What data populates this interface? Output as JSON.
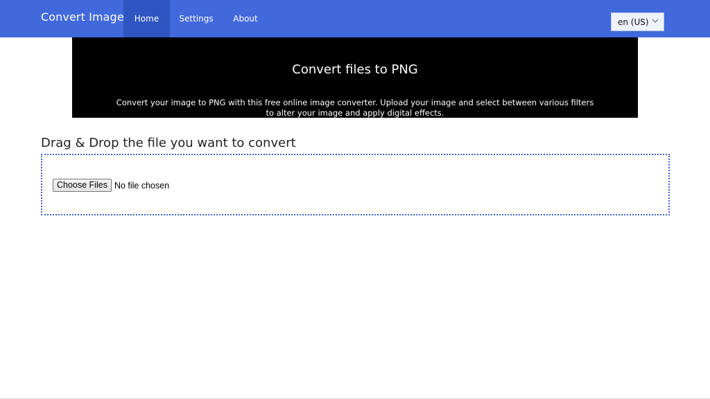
{
  "app": {
    "brand": "Convert Image"
  },
  "nav": {
    "items": [
      {
        "label": "Home",
        "active": true
      },
      {
        "label": "Settings",
        "active": false
      },
      {
        "label": "About",
        "active": false
      }
    ]
  },
  "language": {
    "selected": "en (US)",
    "icon": "chevron-down-icon"
  },
  "hero": {
    "title": "Convert files to PNG",
    "description": "Convert your image to PNG with this free online image converter. Upload your image and select between various filters to alter your image and apply digital effects."
  },
  "upload": {
    "heading": "Drag & Drop the file you want to convert",
    "choose_label": "Choose Files",
    "status": "No file chosen"
  },
  "colors": {
    "navbar": "#4169dc",
    "nav_active": "#2f55c2",
    "hero_bg": "#000000",
    "drop_border": "#3b62cf"
  }
}
